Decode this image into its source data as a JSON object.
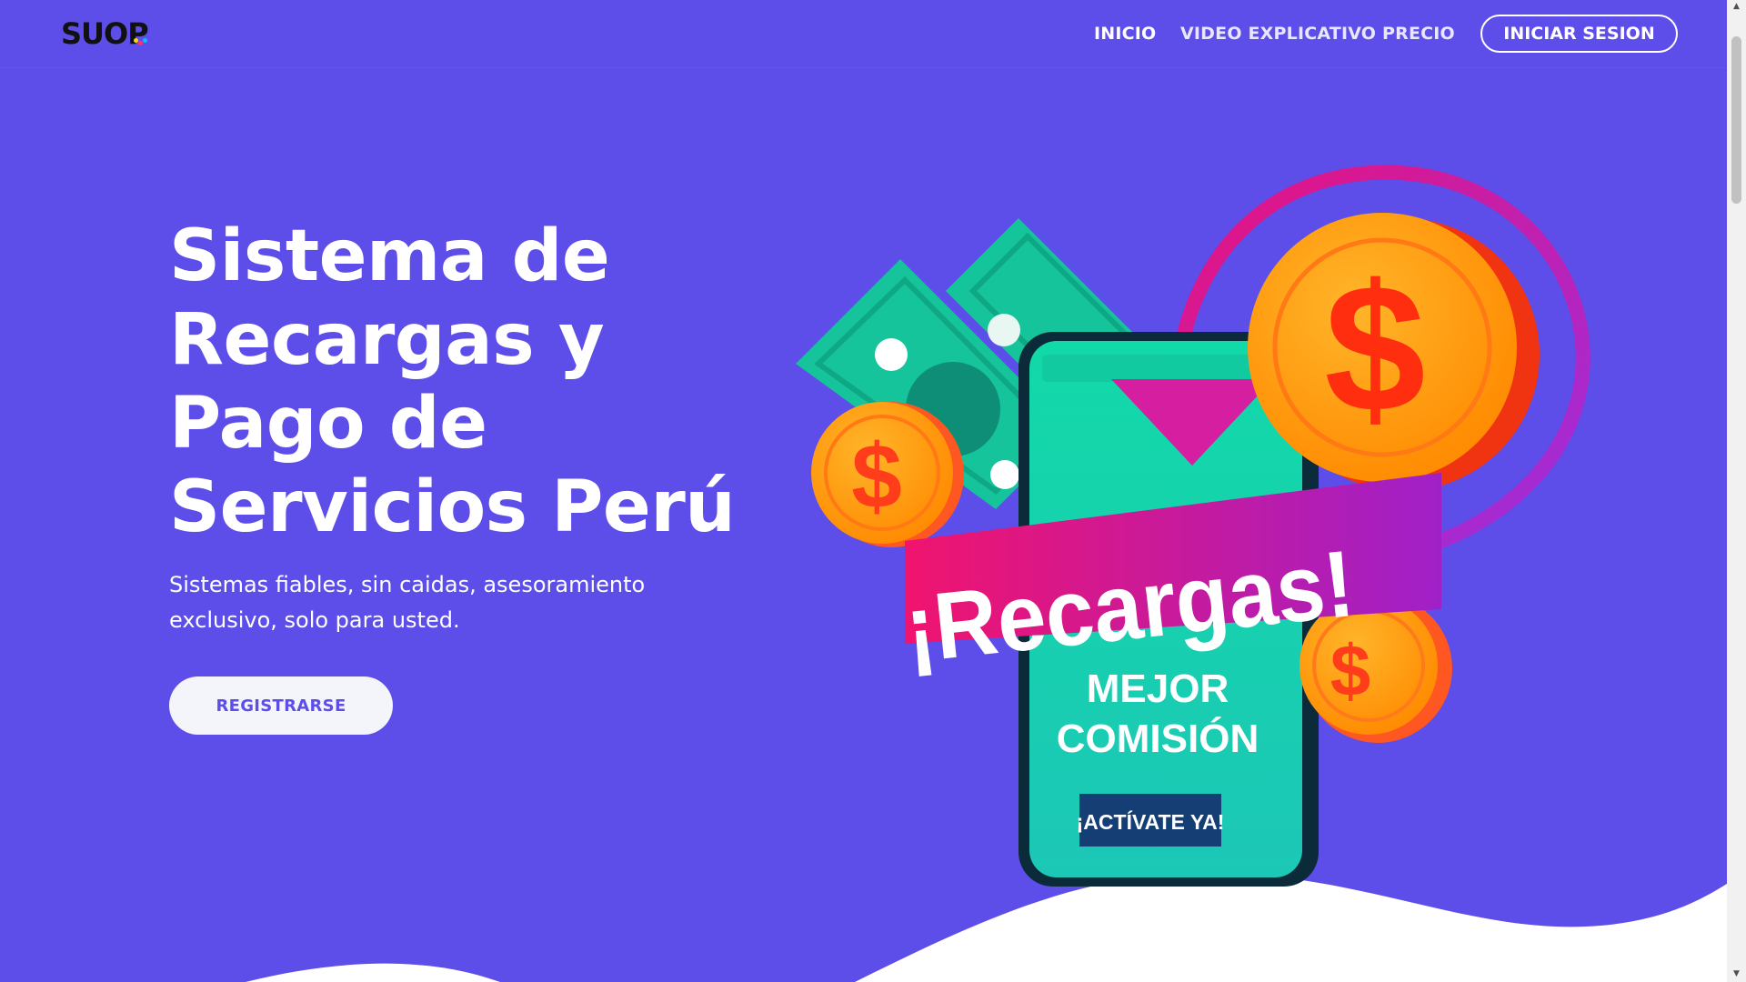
{
  "header": {
    "logo_text": "SUOP",
    "nav": [
      {
        "label": "INICIO",
        "active": true
      },
      {
        "label": "VIDEO EXPLICATIVO",
        "active": false
      },
      {
        "label": "PRECIO",
        "active": false
      }
    ],
    "login_label": "INICIAR SESION"
  },
  "hero": {
    "title_lines": [
      "Sistema de",
      "Recargas y",
      "Pago de",
      "Servicios Perú"
    ],
    "subtitle_lines": [
      "Sistemas fiables, sin caidas, asesoramiento",
      "exclusivo, solo para usted."
    ],
    "register_label": "REGISTRARSE"
  },
  "illustration": {
    "banner_text": "¡Recargas!",
    "phone_line1": "MEJOR",
    "phone_line2": "COMISIÓN",
    "cta_text": "¡ACTÍVATE YA!",
    "currency_symbol": "$"
  },
  "colors": {
    "background": "#5d4de9",
    "phone": "#1fd4b0",
    "coin": "#ff9a0e",
    "banner_start": "#f0146e",
    "banner_end": "#a020c8",
    "cash": "#15c49a"
  }
}
